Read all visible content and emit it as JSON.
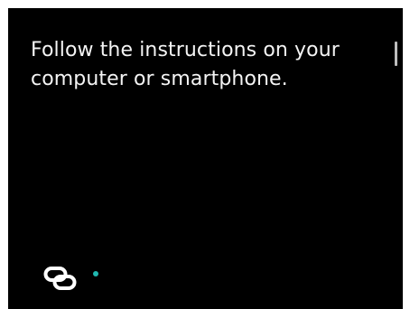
{
  "screen": {
    "message_lines": [
      "Follow the instructions on your",
      "computer or smartphone."
    ]
  },
  "status": {
    "icon": "connection-link-icon",
    "indicator_color": "#20b8b0"
  }
}
